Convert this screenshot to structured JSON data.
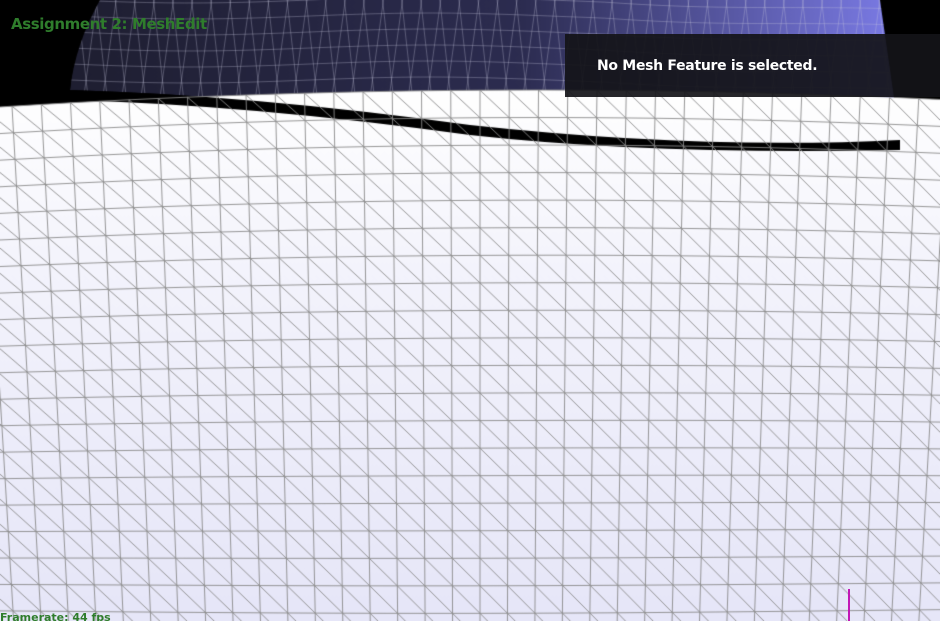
{
  "app": {
    "title": "Assignment 2: MeshEdit",
    "framerate": "Framerate: 44 fps"
  },
  "info_panel": {
    "message": "No Mesh Feature is selected."
  },
  "colors": {
    "title_green": "#2f7d2c",
    "panel_bg": "#141418",
    "panel_text": "#ffffff",
    "mesh_line": "#8a8a8a",
    "mesh_fill_light": "#ffffff",
    "mesh_fill_lavender": "#e6e6f8",
    "mesh_fill_dark": "#1e1e30",
    "mesh_fill_dark_highlight": "#7c7ce8",
    "cursor_magenta": "#c218b6",
    "background": "#000000"
  }
}
